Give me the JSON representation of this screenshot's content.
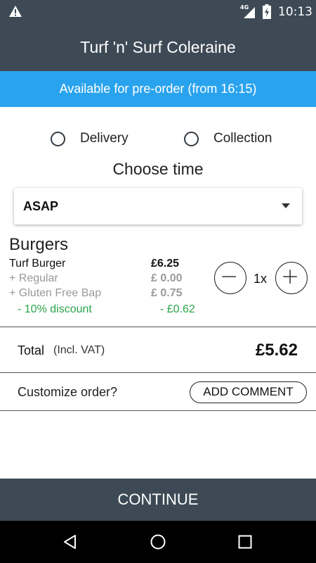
{
  "status": {
    "network": "4G",
    "time": "10:13"
  },
  "header": {
    "title": "Turf 'n' Surf Coleraine"
  },
  "banner": {
    "text": "Available for pre-order (from 16:15)"
  },
  "fulfilment": {
    "options": [
      {
        "label": "Delivery",
        "selected": false
      },
      {
        "label": "Collection",
        "selected": false
      }
    ]
  },
  "time": {
    "heading": "Choose time",
    "selected": "ASAP"
  },
  "order": {
    "category": "Burgers",
    "item": {
      "name": "Turf Burger",
      "price": "£6.25"
    },
    "options": [
      {
        "label": "+ Regular",
        "price": "£ 0.00"
      },
      {
        "label": "+ Gluten Free Bap",
        "price": "£ 0.75"
      }
    ],
    "discount": {
      "label": "- 10% discount",
      "amount": "- £0.62"
    },
    "quantity": "1x"
  },
  "total": {
    "label": "Total",
    "sublabel": "(Incl. VAT)",
    "value": "£5.62"
  },
  "customize": {
    "label": "Customize order?",
    "button": "ADD COMMENT"
  },
  "footer": {
    "continue": "CONTINUE"
  },
  "colors": {
    "header_bg": "#3d4a56",
    "accent": "#2aa3ee",
    "discount": "#2aa34a"
  },
  "icons": [
    "warning-icon",
    "signal-icon",
    "battery-icon",
    "back-icon",
    "home-icon",
    "recents-icon",
    "minus-icon",
    "plus-icon",
    "dropdown-arrow-icon"
  ]
}
